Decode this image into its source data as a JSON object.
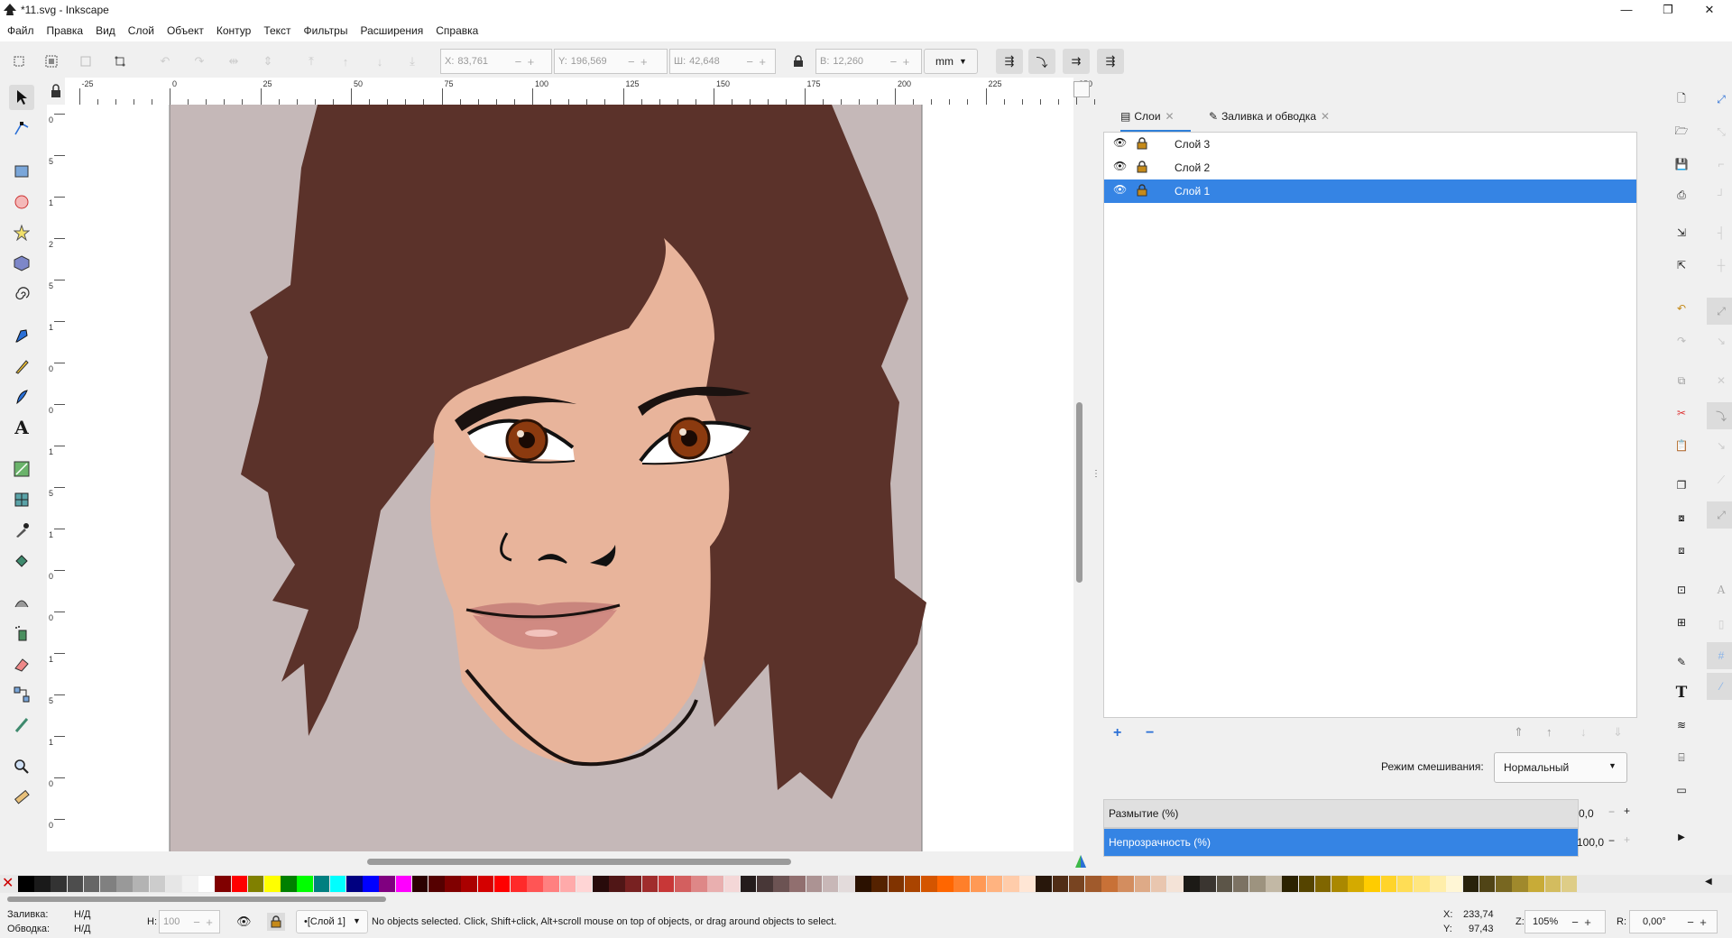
{
  "window": {
    "title": "*11.svg - Inkscape",
    "min": "—",
    "max": "❐",
    "close": "✕"
  },
  "menu": [
    "Файл",
    "Правка",
    "Вид",
    "Слой",
    "Объект",
    "Контур",
    "Текст",
    "Фильтры",
    "Расширения",
    "Справка"
  ],
  "toolbar": {
    "x_label": "X:",
    "x_value": "83,761",
    "y_label": "Y:",
    "y_value": "196,569",
    "w_label": "Ш:",
    "w_value": "42,648",
    "h_label": "В:",
    "h_value": "12,260",
    "unit": "mm"
  },
  "ruler": {
    "h_ticks": [
      "-25",
      "0",
      "25",
      "50",
      "75",
      "100",
      "125",
      "150",
      "175",
      "200",
      "225",
      "250"
    ],
    "v_ticks": [
      "0",
      "5",
      "1",
      "2",
      "5",
      "1",
      "0",
      "0",
      "1",
      "5",
      "1",
      "0",
      "0",
      "1",
      "5",
      "1",
      "0",
      "0"
    ]
  },
  "dock": {
    "tabs": [
      {
        "label": "Слои",
        "close": "✕"
      },
      {
        "label": "Заливка и обводка",
        "close": "✕"
      }
    ],
    "layers": [
      {
        "name": "Слой 3",
        "selected": false
      },
      {
        "name": "Слой 2",
        "selected": false
      },
      {
        "name": "Слой 1",
        "selected": true
      }
    ],
    "blend_label": "Режим смешивания:",
    "blend_value": "Нормальный",
    "blur_label": "Размытие (%)",
    "blur_value": "0,0",
    "opacity_label": "Непрозрачность (%)",
    "opacity_value": "100,0",
    "opacity_fill": 1.0
  },
  "palette": [
    "#000000",
    "#1a1a1a",
    "#333333",
    "#4d4d4d",
    "#666666",
    "#808080",
    "#999999",
    "#b3b3b3",
    "#cccccc",
    "#e6e6e6",
    "#f2f2f2",
    "#ffffff",
    "#800000",
    "#ff0000",
    "#808000",
    "#ffff00",
    "#008000",
    "#00ff00",
    "#008080",
    "#00ffff",
    "#000080",
    "#0000ff",
    "#800080",
    "#ff00ff",
    "#2b0000",
    "#550000",
    "#800000",
    "#aa0000",
    "#d40000",
    "#ff0000",
    "#ff2a2a",
    "#ff5555",
    "#ff8080",
    "#ffaaaa",
    "#ffd5d5",
    "#280b0b",
    "#501616",
    "#782121",
    "#a02c2c",
    "#c83737",
    "#d35f5f",
    "#de8787",
    "#e9afaf",
    "#f4d7d7",
    "#241c1c",
    "#483737",
    "#6c5353",
    "#916f6f",
    "#ac9393",
    "#c8b7b7",
    "#e3dbdb",
    "#2b1100",
    "#552200",
    "#803300",
    "#aa4400",
    "#d45500",
    "#ff6600",
    "#ff7f2a",
    "#ff9955",
    "#ffb380",
    "#ffccaa",
    "#ffe6d5",
    "#28170b",
    "#502d16",
    "#784421",
    "#a05a2c",
    "#c87137",
    "#d38d5f",
    "#deaa87",
    "#e9c6af",
    "#f4e3d7",
    "#1c1a16",
    "#3a3530",
    "#5c5548",
    "#7c7263",
    "#9d937f",
    "#c2b8a5",
    "#2b2200",
    "#554400",
    "#806600",
    "#aa8800",
    "#d4aa00",
    "#ffcc00",
    "#ffd42a",
    "#ffdd55",
    "#ffe680",
    "#ffeeaa",
    "#fff6d5",
    "#28220b",
    "#504416",
    "#786721",
    "#a0892c",
    "#c8ab37",
    "#d3bc5f",
    "#decd87"
  ],
  "status": {
    "fill_label": "Заливка:",
    "fill_value": "Н/Д",
    "stroke_label": "Обводка:",
    "stroke_value": "Н/Д",
    "h_label": "H:",
    "h_value": "100",
    "layer_value": "•[Слой 1]",
    "message": "No objects selected. Click, Shift+click, Alt+scroll mouse on top of objects, or drag around objects to select.",
    "x_label": "X:",
    "x_value": "233,74",
    "y_label": "Y:",
    "y_value": "97,43",
    "zoom_label": "Z:",
    "zoom_value": "105%",
    "rot_label": "R:",
    "rot_value": "0,00°"
  },
  "colors": {
    "page_bg": "#c5b8b8",
    "hair": "#5b322a",
    "skin": "#e8b49b",
    "iris": "#8b3a0f",
    "lips": "#d08a82",
    "selection": "#3584e4"
  }
}
